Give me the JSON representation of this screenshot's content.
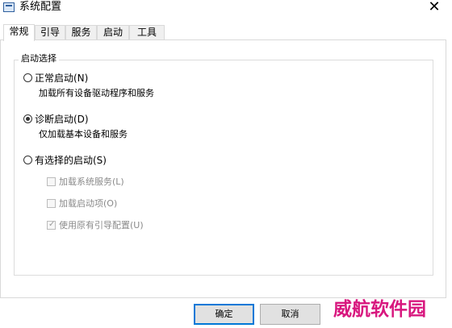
{
  "window": {
    "title": "系统配置",
    "close_glyph": "✕"
  },
  "tabs": [
    {
      "label": "常规",
      "active": true
    },
    {
      "label": "引导",
      "active": false
    },
    {
      "label": "服务",
      "active": false
    },
    {
      "label": "启动",
      "active": false
    },
    {
      "label": "工具",
      "active": false
    }
  ],
  "startup_group": {
    "legend": "启动选择",
    "options": [
      {
        "label": "正常启动(N)",
        "description": "加载所有设备驱动程序和服务",
        "selected": false
      },
      {
        "label": "诊断启动(D)",
        "description": "仅加载基本设备和服务",
        "selected": true
      },
      {
        "label": "有选择的启动(S)",
        "description": "",
        "selected": false
      }
    ],
    "selective_items": [
      {
        "label": "加载系统服务(L)",
        "checked": false,
        "enabled": false
      },
      {
        "label": "加载启动项(O)",
        "checked": false,
        "enabled": false
      },
      {
        "label": "使用原有引导配置(U)",
        "checked": true,
        "enabled": false
      }
    ]
  },
  "buttons": {
    "ok": "确定",
    "cancel": "取消"
  },
  "watermark": {
    "text": "威航软件园",
    "color": "#d8177e"
  },
  "icons": {
    "app": "system-config-app-icon",
    "close": "close-icon",
    "checkmark": "✓"
  }
}
